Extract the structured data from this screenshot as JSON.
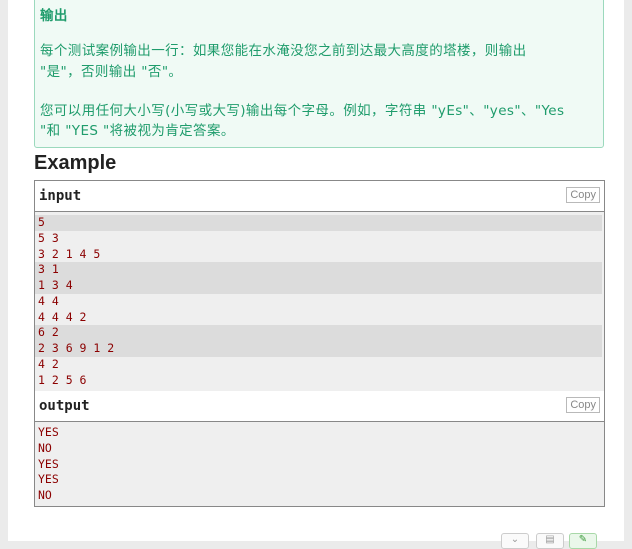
{
  "translation": {
    "heading": "输出",
    "paragraph1_line1": "每个测试案例输出一行：如果您能在水淹没您之前到达最大高度的塔楼，则输出",
    "paragraph1_line2": "\"是\"，否则输出 \"否\"。",
    "paragraph2_line1": "您可以用任何大小写(小写或大写)输出每个字母。例如，字符串 \"yEs\"、\"yes\"、\"Yes",
    "paragraph2_line2": "\"和 \"YES \"将被视为肯定答案。"
  },
  "example": {
    "title": "Example",
    "input": {
      "label": "input",
      "copy_label": "Copy",
      "lines": [
        {
          "text": "5",
          "highlight": true
        },
        {
          "text": "5 3",
          "highlight": false
        },
        {
          "text": "3 2 1 4 5",
          "highlight": false
        },
        {
          "text": "3 1",
          "highlight": true
        },
        {
          "text": "1 3 4",
          "highlight": true
        },
        {
          "text": "4 4",
          "highlight": false
        },
        {
          "text": "4 4 4 2",
          "highlight": false
        },
        {
          "text": "6 2",
          "highlight": true
        },
        {
          "text": "2 3 6 9 1 2",
          "highlight": true
        },
        {
          "text": "4 2",
          "highlight": false
        },
        {
          "text": "1 2 5 6",
          "highlight": false
        }
      ]
    },
    "output": {
      "label": "output",
      "copy_label": "Copy",
      "lines": [
        {
          "text": "YES",
          "highlight": false
        },
        {
          "text": "NO",
          "highlight": false
        },
        {
          "text": "YES",
          "highlight": false
        },
        {
          "text": "YES",
          "highlight": false
        },
        {
          "text": "NO",
          "highlight": false
        }
      ]
    }
  },
  "footer_icons": [
    "expand-icon",
    "clipboard-icon",
    "edit-icon"
  ]
}
